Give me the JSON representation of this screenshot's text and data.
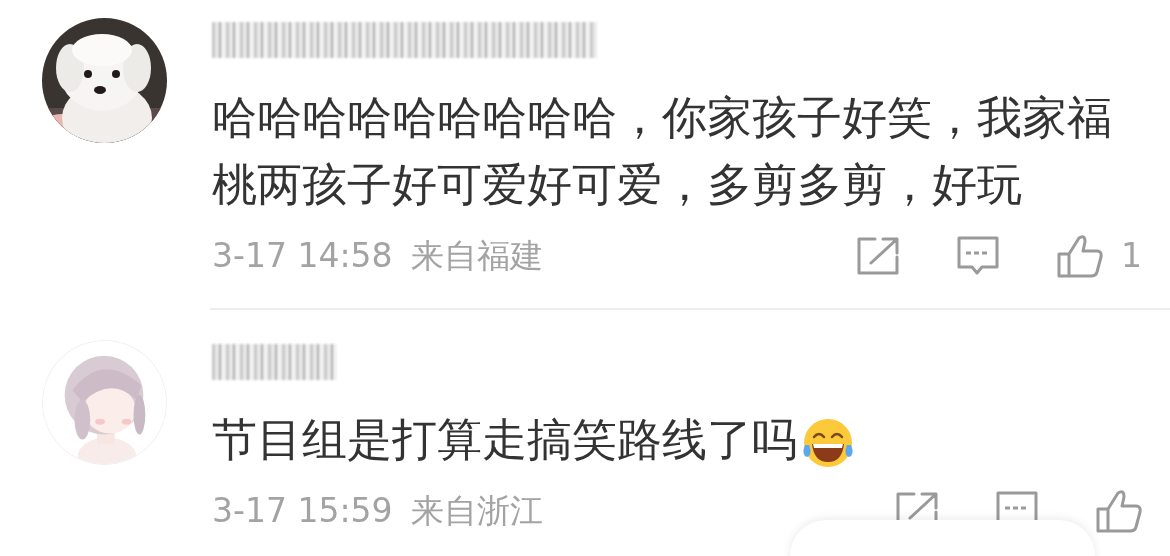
{
  "comments": [
    {
      "text": "哈哈哈哈哈哈哈哈哈，你家孩子好笑，我家福桃两孩子好可爱好可爱，多剪多剪，好玩",
      "time": "3-17 14:58",
      "location": "来自福建",
      "likes": "1"
    },
    {
      "text": "节目组是打算走搞笑路线了吗",
      "laughing_emoji": true,
      "time": "3-17 15:59",
      "location": "来自浙江"
    }
  ]
}
